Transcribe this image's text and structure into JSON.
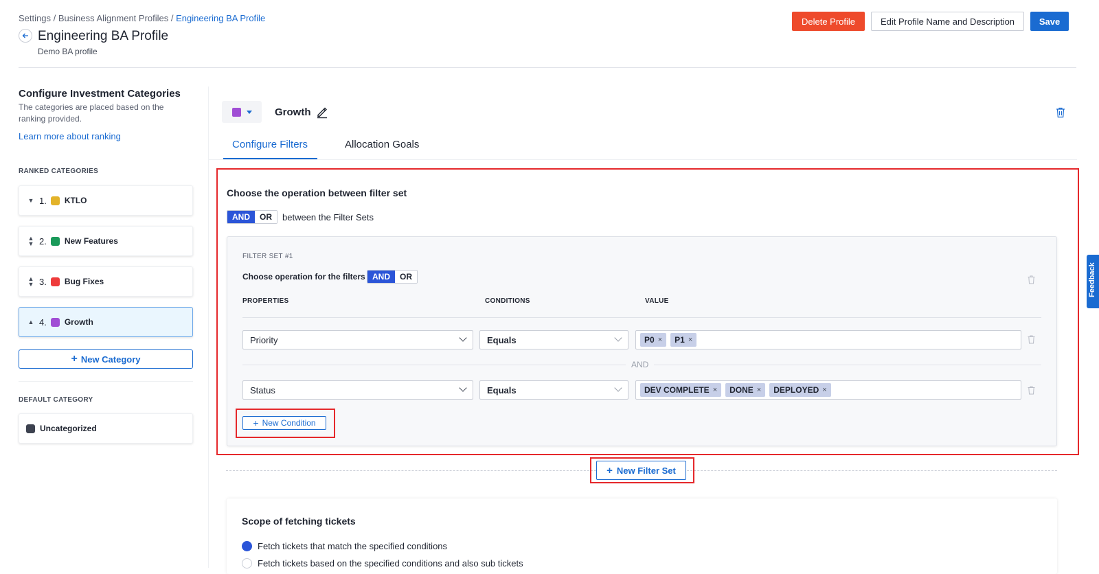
{
  "breadcrumb": {
    "part1": "Settings",
    "sep1": " / ",
    "part2": "Business Alignment Profiles",
    "sep2": " / ",
    "current": "Engineering BA Profile"
  },
  "header": {
    "title": "Engineering BA Profile",
    "subtitle": "Demo BA profile",
    "delete_label": "Delete Profile",
    "edit_label": "Edit Profile Name and Description",
    "save_label": "Save"
  },
  "sidebar": {
    "title": "Configure Investment Categories",
    "description": "The categories are placed based on the ranking provided.",
    "learn_more": "Learn more about ranking",
    "ranked_label": "RANKED CATEGORIES",
    "categories": [
      {
        "num": "1.",
        "name": "KTLO",
        "color": "#e3b32a",
        "sort": "down"
      },
      {
        "num": "2.",
        "name": "New Features",
        "color": "#1a9a5a",
        "sort": "both"
      },
      {
        "num": "3.",
        "name": "Bug Fixes",
        "color": "#ee3b3b",
        "sort": "both"
      },
      {
        "num": "4.",
        "name": "Growth",
        "color": "#a04ed5",
        "sort": "up",
        "active": true
      }
    ],
    "new_category_label": "New Category",
    "default_label": "DEFAULT CATEGORY",
    "default_category": {
      "name": "Uncategorized",
      "color": "#3d4250"
    }
  },
  "main": {
    "category_name": "Growth",
    "category_color": "#a04ed5",
    "tabs": [
      {
        "label": "Configure Filters",
        "active": true
      },
      {
        "label": "Allocation Goals",
        "active": false
      }
    ],
    "operation_title": "Choose the operation between filter set",
    "set_op": {
      "and": "AND",
      "or": "OR",
      "selected": "AND"
    },
    "between_text": "between the Filter Sets",
    "filter_set": {
      "label": "FILTER SET #1",
      "op_text": "Choose operation for the filters",
      "op": {
        "and": "AND",
        "or": "OR",
        "selected": "AND"
      },
      "columns": {
        "properties": "PROPERTIES",
        "conditions": "CONDITIONS",
        "value": "VALUE"
      },
      "rows": [
        {
          "property": "Priority",
          "condition": "Equals",
          "values": [
            "P0",
            "P1"
          ]
        },
        {
          "property": "Status",
          "condition": "Equals",
          "values": [
            "DEV COMPLETE",
            "DONE",
            "DEPLOYED"
          ]
        }
      ],
      "separator": "AND",
      "new_condition_label": "New Condition"
    },
    "new_filter_set_label": "New Filter Set",
    "scope": {
      "title": "Scope of fetching tickets",
      "options": [
        {
          "label": "Fetch tickets that match the specified conditions",
          "checked": true
        },
        {
          "label": "Fetch tickets based on the specified conditions and also sub tickets",
          "checked": false
        }
      ]
    }
  },
  "feedback_label": "Feedback",
  "colors": {
    "accent": "#1a6bd1",
    "danger": "#ee4a2b",
    "toggle_on": "#2b55d8",
    "highlight": "#e5282b"
  }
}
